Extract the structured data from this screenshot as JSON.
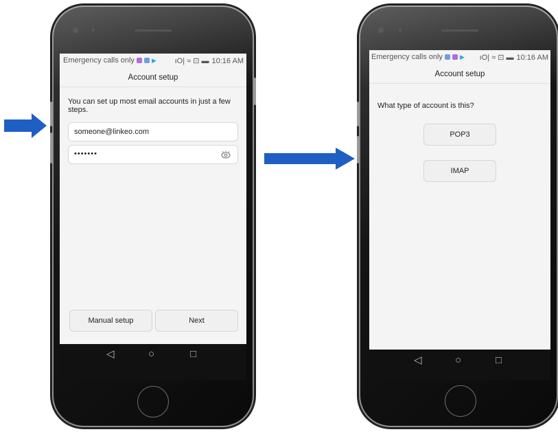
{
  "colors": {
    "arrow": "#1f5fc4",
    "notif_icon1": "#b06ce0",
    "notif_icon2": "#6fa0d8",
    "play_icon": "#2ea8e6"
  },
  "left_phone": {
    "status": {
      "carrier": "Emergency calls only",
      "time": "10:16 AM",
      "icons": "ıO| ≈ ⊡ ▬"
    },
    "title": "Account setup",
    "intro": "You can set up most email accounts in just a few steps.",
    "email_value": "someone@linkeo.com",
    "password_value": "•••••••",
    "show_password_icon": "eye-icon",
    "manual_setup_label": "Manual setup",
    "next_label": "Next",
    "nav": {
      "back": "◁",
      "home": "○",
      "recents": "□"
    }
  },
  "right_phone": {
    "status": {
      "carrier": "Emergency calls only",
      "time": "10:16 AM",
      "icons": "ıO| ≈ ⊡ ▬"
    },
    "title": "Account setup",
    "question": "What type of account is this?",
    "pop3_label": "POP3",
    "imap_label": "IMAP",
    "nav": {
      "back": "◁",
      "home": "○",
      "recents": "□"
    }
  }
}
